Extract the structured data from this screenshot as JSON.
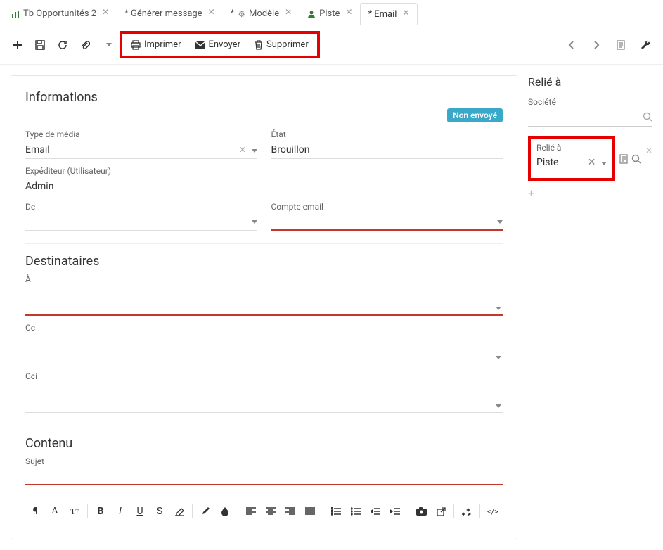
{
  "tabs": [
    {
      "label": "Tb Opportunités 2",
      "icon": "chart",
      "closable": true,
      "active": false,
      "iconColor": "#2e7d32"
    },
    {
      "label": "*  Générer message",
      "icon": "",
      "closable": true,
      "active": false
    },
    {
      "label": "* ",
      "label2": " Modèle",
      "icon": "gear",
      "closable": true,
      "active": false,
      "iconColor": "#888"
    },
    {
      "label": "",
      "label2": " Piste",
      "icon": "user",
      "closable": true,
      "active": false,
      "iconColor": "#2e7d32"
    },
    {
      "label": "*  Email",
      "icon": "",
      "closable": true,
      "active": true
    }
  ],
  "toolbar": {
    "print": "Imprimer",
    "send": "Envoyer",
    "delete": "Supprimer"
  },
  "sections": {
    "info": "Informations",
    "dest": "Destinataires",
    "content": "Contenu"
  },
  "badge": "Non envoyé",
  "fields": {
    "media_label": "Type de média",
    "media_value": "Email",
    "state_label": "État",
    "state_value": "Brouillon",
    "sender_label": "Expéditeur (Utilisateur)",
    "sender_value": "Admin",
    "from_label": "De",
    "account_label": "Compte email",
    "to_label": "À",
    "cc_label": "Cc",
    "bcc_label": "Cci",
    "subject_label": "Sujet"
  },
  "side": {
    "title": "Relié à",
    "company_label": "Société",
    "relie_label": "Relié à",
    "relie_value": "Piste"
  }
}
